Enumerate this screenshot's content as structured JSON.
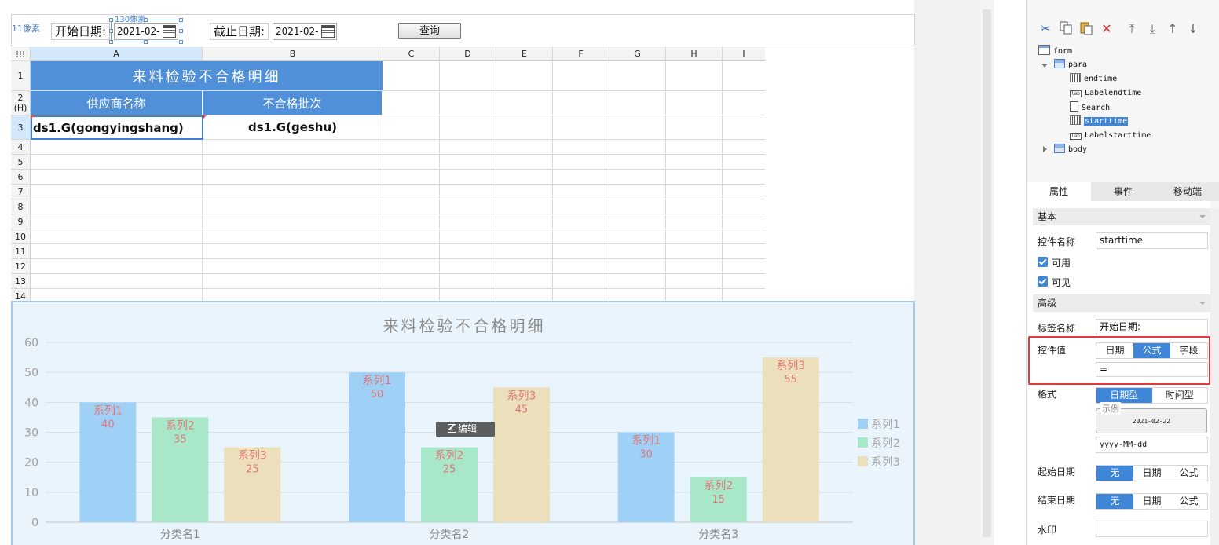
{
  "params": {
    "px_label_left": "11像素",
    "px_label_top": "130像素",
    "start_label": "开始日期:",
    "start_value": "2021-02-",
    "end_label": "截止日期:",
    "end_value": "2021-02-",
    "query_label": "查询"
  },
  "sheet": {
    "columns": [
      "A",
      "B",
      "C",
      "D",
      "E",
      "F",
      "G",
      "H",
      "I"
    ],
    "rows": [
      "1",
      "2 (H)",
      "3",
      "4",
      "5",
      "6",
      "7",
      "8",
      "9",
      "10",
      "11",
      "12",
      "13",
      "14"
    ],
    "title": "来料检验不合格明细",
    "header_a": "供应商名称",
    "header_b": "不合格批次",
    "formula_a": "ds1.G(gongyingshang)",
    "formula_b": "ds1.G(geshu)"
  },
  "chart_data": {
    "type": "bar",
    "title": "来料检验不合格明细",
    "categories": [
      "分类名1",
      "分类名2",
      "分类名3"
    ],
    "series": [
      {
        "name": "系列1",
        "values": [
          40,
          50,
          30
        ],
        "color": "#9fd1f7"
      },
      {
        "name": "系列2",
        "values": [
          35,
          25,
          15
        ],
        "color": "#a8e8c8"
      },
      {
        "name": "系列3",
        "values": [
          25,
          45,
          55
        ],
        "color": "#ece0bc"
      }
    ],
    "yticks": [
      0,
      10,
      20,
      30,
      40,
      50,
      60
    ],
    "ylim": [
      0,
      60
    ],
    "xlabel": "",
    "ylabel": "",
    "grid": true,
    "legend": "right",
    "label_color": "#e0787c",
    "edit_label": "编辑"
  },
  "panel": {
    "tree": {
      "form": "form",
      "para": "para",
      "endtime": "endtime",
      "labelendtime": "Labelendtime",
      "search": "Search",
      "starttime": "starttime",
      "labelstarttime": "Labelstarttime",
      "body": "body"
    },
    "tabs": [
      "属性",
      "事件",
      "移动端"
    ],
    "basic": "基本",
    "name_label": "控件名称",
    "name_value": "starttime",
    "enabled": "可用",
    "visible": "可见",
    "advanced": "高级",
    "tag_label": "标签名称",
    "tag_value": "开始日期:",
    "value_label": "控件值",
    "value_modes": [
      "日期",
      "公式",
      "字段"
    ],
    "value_text": "=",
    "format_label": "格式",
    "format_modes": [
      "日期型",
      "时间型"
    ],
    "example_legend": "示例",
    "example_value": "2021-02-22",
    "format_value": "yyyy-MM-dd",
    "start_date_label": "起始日期",
    "end_date_label": "结束日期",
    "date_modes": [
      "无",
      "日期",
      "公式"
    ],
    "watermark_label": "水印"
  }
}
